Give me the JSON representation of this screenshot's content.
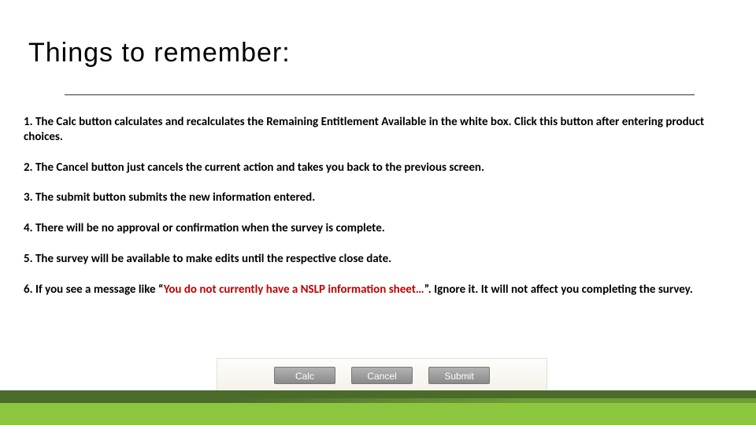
{
  "title": "Things to remember:",
  "items": [
    {
      "prefix": "1. ",
      "text": "The Calc button calculates and recalculates the Remaining Entitlement Available in the white box. Click this button after entering product choices."
    },
    {
      "prefix": "2. ",
      "text": "The Cancel button just cancels the current action and takes you back to the previous screen."
    },
    {
      "prefix": "3. ",
      "text": "The submit button submits the new information entered."
    },
    {
      "prefix": "4. ",
      "text": "There will be no approval or confirmation when the survey is complete."
    },
    {
      "prefix": "5. ",
      "text": "The survey will be available to make edits until the respective close date."
    }
  ],
  "item6": {
    "prefix": "6.  ",
    "before": "If you see a message like “",
    "highlight": "You do not currently have a NSLP information sheet…",
    "after": "”. Ignore it. It will not affect you completing the survey."
  },
  "buttons": {
    "calc": "Calc",
    "cancel": "Cancel",
    "submit": "Submit"
  }
}
